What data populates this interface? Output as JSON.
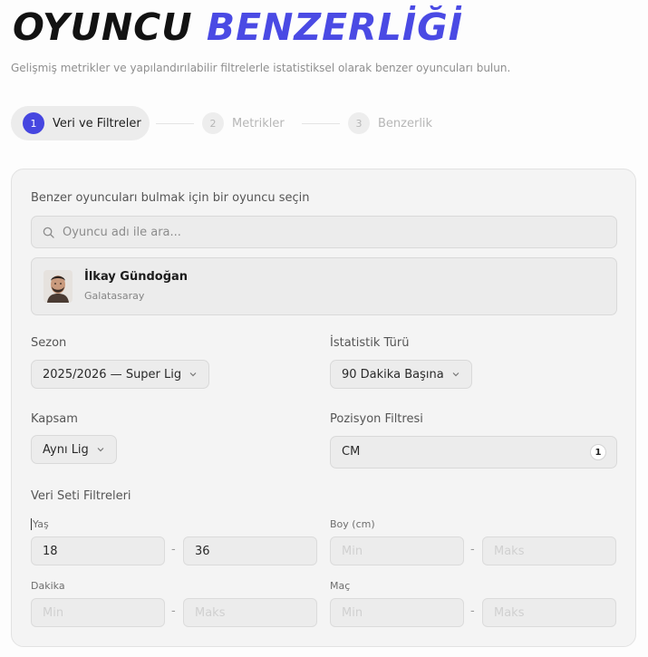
{
  "header": {
    "title_part1": "OYUNCU",
    "title_part2": "BENZERLİĞİ",
    "subtitle": "Gelişmiş metrikler ve yapılandırılabilir filtrelerle istatistiksel olarak benzer oyuncuları bulun."
  },
  "steps": [
    {
      "num": "1",
      "label": "Veri ve Filtreler",
      "active": true
    },
    {
      "num": "2",
      "label": "Metrikler",
      "active": false
    },
    {
      "num": "3",
      "label": "Benzerlik",
      "active": false
    }
  ],
  "player_select": {
    "label": "Benzer oyuncuları bulmak için bir oyuncu seçin",
    "search_placeholder": "Oyuncu adı ile ara...",
    "selected_name": "İlkay Gündoğan",
    "selected_team": "Galatasaray"
  },
  "season": {
    "label": "Sezon",
    "value": "2025/2026 — Super Lig"
  },
  "stat_type": {
    "label": "İstatistik Türü",
    "value": "90 Dakika Başına"
  },
  "scope": {
    "label": "Kapsam",
    "value": "Aynı Lig"
  },
  "position_filter": {
    "label": "Pozisyon Filtresi",
    "value": "CM",
    "count": "1"
  },
  "dataset_filters": {
    "label": "Veri Seti Filtreleri",
    "age": {
      "label": "Yaş",
      "min": "18",
      "max": "36"
    },
    "height": {
      "label": "Boy (cm)",
      "min_placeholder": "Min",
      "max_placeholder": "Maks"
    },
    "minutes": {
      "label": "Dakika",
      "min_placeholder": "Min",
      "max_placeholder": "Maks"
    },
    "matches": {
      "label": "Maç",
      "min_placeholder": "Min",
      "max_placeholder": "Maks"
    },
    "separator": "-"
  },
  "colors": {
    "accent": "#4a4ae4",
    "title_dark": "#121212",
    "card_bg": "#f4f4f4"
  },
  "icons": {
    "search": "search-icon",
    "chevron": "chevron-down-icon",
    "avatar": "player-avatar"
  }
}
